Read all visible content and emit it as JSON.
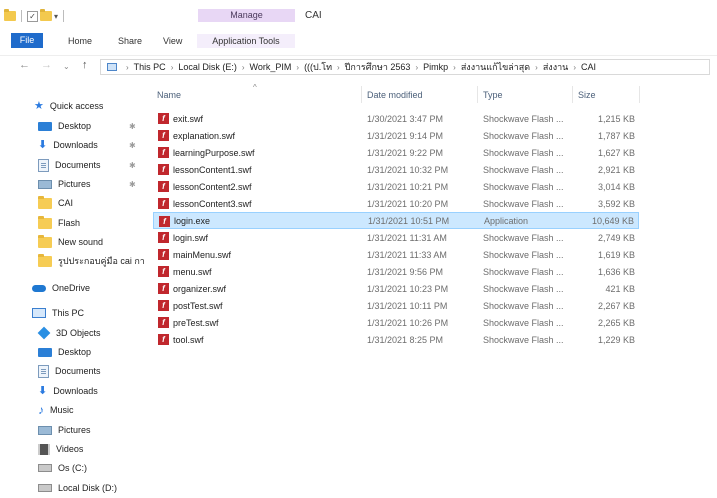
{
  "window": {
    "title": "CAI",
    "manage_label": "Manage",
    "qat_arrow": "▾"
  },
  "ribbon": {
    "tabs": [
      "File",
      "Home",
      "Share",
      "View",
      "Application Tools"
    ]
  },
  "address": {
    "nav": {
      "back": "←",
      "forward": "→",
      "recent": "⌄",
      "up": "↑"
    },
    "breadcrumb": [
      "This PC",
      "Local Disk (E:)",
      "Work_PIM",
      "(((ป.โท",
      "ปีการศึกษา 2563",
      "Pimkp",
      "ส่งงานแก้ไขล่าสุด",
      "ส่งงาน",
      "CAI"
    ],
    "separator": "›"
  },
  "navpane": {
    "items": [
      {
        "label": "Quick access",
        "icon": "star-icon",
        "pinned": false
      },
      {
        "label": "Desktop",
        "icon": "desktop-icon",
        "pinned": true
      },
      {
        "label": "Downloads",
        "icon": "download-icon",
        "pinned": true
      },
      {
        "label": "Documents",
        "icon": "documents-icon",
        "pinned": true
      },
      {
        "label": "Pictures",
        "icon": "pictures-icon",
        "pinned": true
      },
      {
        "label": "CAI",
        "icon": "folder-icon",
        "pinned": false
      },
      {
        "label": "Flash",
        "icon": "folder-icon",
        "pinned": false
      },
      {
        "label": "New sound",
        "icon": "folder-icon",
        "pinned": false
      },
      {
        "label": "รูปประกอบคู่มือ cai กา",
        "icon": "folder-icon",
        "pinned": false
      },
      {
        "label": "OneDrive",
        "icon": "cloud-icon",
        "pinned": false
      },
      {
        "label": "This PC",
        "icon": "computer-icon",
        "pinned": false
      },
      {
        "label": "3D Objects",
        "icon": "3d-objects-icon",
        "pinned": false
      },
      {
        "label": "Desktop",
        "icon": "desktop-icon",
        "pinned": false
      },
      {
        "label": "Documents",
        "icon": "documents-icon",
        "pinned": false
      },
      {
        "label": "Downloads",
        "icon": "download-icon",
        "pinned": false
      },
      {
        "label": "Music",
        "icon": "music-icon",
        "pinned": false
      },
      {
        "label": "Pictures",
        "icon": "pictures-icon",
        "pinned": false
      },
      {
        "label": "Videos",
        "icon": "videos-icon",
        "pinned": false
      },
      {
        "label": "Os (C:)",
        "icon": "drive-icon",
        "pinned": false
      },
      {
        "label": "Local Disk (D:)",
        "icon": "drive-icon",
        "pinned": false
      }
    ],
    "pin_glyph": "✱"
  },
  "filelist": {
    "columns": {
      "name": "Name",
      "date": "Date modified",
      "type": "Type",
      "size": "Size"
    },
    "sort_glyph": "^",
    "files": [
      {
        "name": "exit.swf",
        "date": "1/30/2021 3:47 PM",
        "type": "Shockwave Flash ...",
        "size": "1,215 KB",
        "selected": false
      },
      {
        "name": "explanation.swf",
        "date": "1/31/2021 9:14 PM",
        "type": "Shockwave Flash ...",
        "size": "1,787 KB",
        "selected": false
      },
      {
        "name": "learningPurpose.swf",
        "date": "1/31/2021 9:22 PM",
        "type": "Shockwave Flash ...",
        "size": "1,627 KB",
        "selected": false
      },
      {
        "name": "lessonContent1.swf",
        "date": "1/31/2021 10:32 PM",
        "type": "Shockwave Flash ...",
        "size": "2,921 KB",
        "selected": false
      },
      {
        "name": "lessonContent2.swf",
        "date": "1/31/2021 10:21 PM",
        "type": "Shockwave Flash ...",
        "size": "3,014 KB",
        "selected": false
      },
      {
        "name": "lessonContent3.swf",
        "date": "1/31/2021 10:20 PM",
        "type": "Shockwave Flash ...",
        "size": "3,592 KB",
        "selected": false
      },
      {
        "name": "login.exe",
        "date": "1/31/2021 10:51 PM",
        "type": "Application",
        "size": "10,649 KB",
        "selected": true
      },
      {
        "name": "login.swf",
        "date": "1/31/2021 11:31 AM",
        "type": "Shockwave Flash ...",
        "size": "2,749 KB",
        "selected": false
      },
      {
        "name": "mainMenu.swf",
        "date": "1/31/2021 11:33 AM",
        "type": "Shockwave Flash ...",
        "size": "1,619 KB",
        "selected": false
      },
      {
        "name": "menu.swf",
        "date": "1/31/2021 9:56 PM",
        "type": "Shockwave Flash ...",
        "size": "1,636 KB",
        "selected": false
      },
      {
        "name": "organizer.swf",
        "date": "1/31/2021 10:23 PM",
        "type": "Shockwave Flash ...",
        "size": "421 KB",
        "selected": false
      },
      {
        "name": "postTest.swf",
        "date": "1/31/2021 10:11 PM",
        "type": "Shockwave Flash ...",
        "size": "2,267 KB",
        "selected": false
      },
      {
        "name": "preTest.swf",
        "date": "1/31/2021 10:26 PM",
        "type": "Shockwave Flash ...",
        "size": "2,265 KB",
        "selected": false
      },
      {
        "name": "tool.swf",
        "date": "1/31/2021 8:25 PM",
        "type": "Shockwave Flash ...",
        "size": "1,229 KB",
        "selected": false
      }
    ],
    "file_icon_glyph": "f"
  },
  "colors": {
    "accent": "#1f6bcb",
    "selection": "#cce8ff",
    "manage_tab": "#e8d7f5",
    "flash_icon": "#c0272d"
  }
}
